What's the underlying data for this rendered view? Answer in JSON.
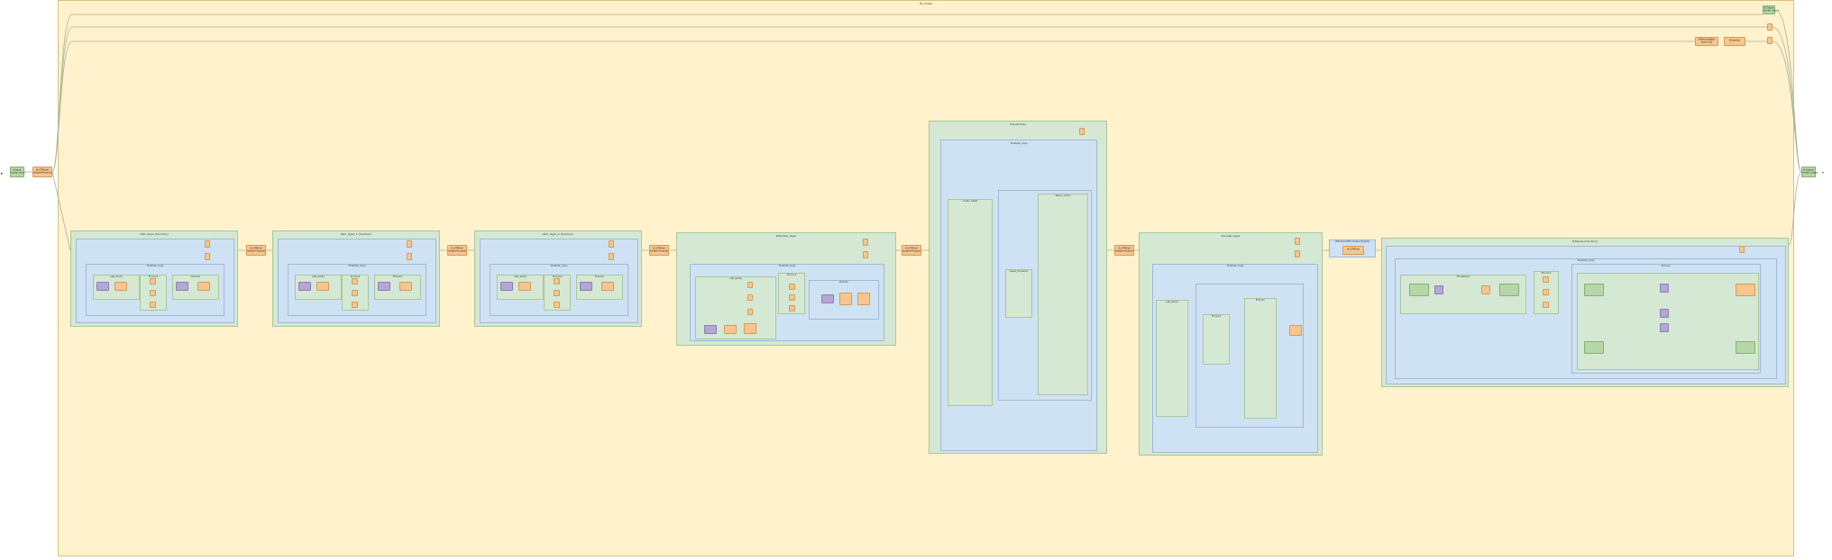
{
  "graph": {
    "outer_title": "fit_model",
    "start_node": "tf.Input\nmodel_input",
    "end_node": "tf.Output\nmodel_output",
    "entry_node": "tf.LSTMCell\n(shape=[input])",
    "top_nodes": [
      "tf.Output\nmodel_output",
      "tf.ReduceMean",
      "tf.ReduceMean\n(axis=[1])",
      "tf.Identity"
    ],
    "mid_nodes": [
      "tf.LSTMCell\n(shape=[input])",
      "tf.LSTMCell\n(shape=[input])",
      "tf.LSTMCell\n(shape=[input])",
      "tf.LSTMCell\n(shape=[input])",
      "tf.LSTMCell\n(shape=[input])",
      "tf.LSTMCell",
      "tf.GatherNd"
    ],
    "clusters": [
      {
        "title": "lstm_layer\n(function)",
        "inner": "tf.while_loop",
        "sub_a": "cell_body",
        "sub_b": "tf.cond",
        "sub_c": "tf.scan"
      },
      {
        "title": "lstm_layer_1\n(function)",
        "inner": "tf.while_loop",
        "sub_a": "cell_body",
        "sub_b": "tf.cond",
        "sub_c": "tf.scan"
      },
      {
        "title": "lstm_layer_2\n(function)",
        "inner": "tf.while_loop",
        "sub_a": "cell_body",
        "sub_b": "tf.cond",
        "sub_c": "tf.scan"
      },
      {
        "title": "attention_layer",
        "inner": "tf.while_loop",
        "sub_a": "cell_body",
        "sub_b": "tf.cond",
        "sub_c": "tf.scan"
      },
      {
        "title": "transformer",
        "inner": "tf.while_loop",
        "sub_a": "multi_head",
        "sub_b": "feed_forward",
        "sub_c": "layer_norm"
      },
      {
        "title": "decoder_layer",
        "inner": "tf.while_loop",
        "sub_a": "cell_body",
        "sub_b": "tf.cond",
        "sub_c": "tf.scan"
      },
      {
        "title": "tf.Dense\n(function)",
        "inner": "tf.while_loop",
        "sub_a": "tf.matmul",
        "sub_b": "tf.cond",
        "sub_c": "tf.scan"
      }
    ],
    "small_label": "tf.BroadcastTo\n(shape=[input])",
    "side_node": "tf.Add",
    "side_node2": "tf.Relu"
  }
}
